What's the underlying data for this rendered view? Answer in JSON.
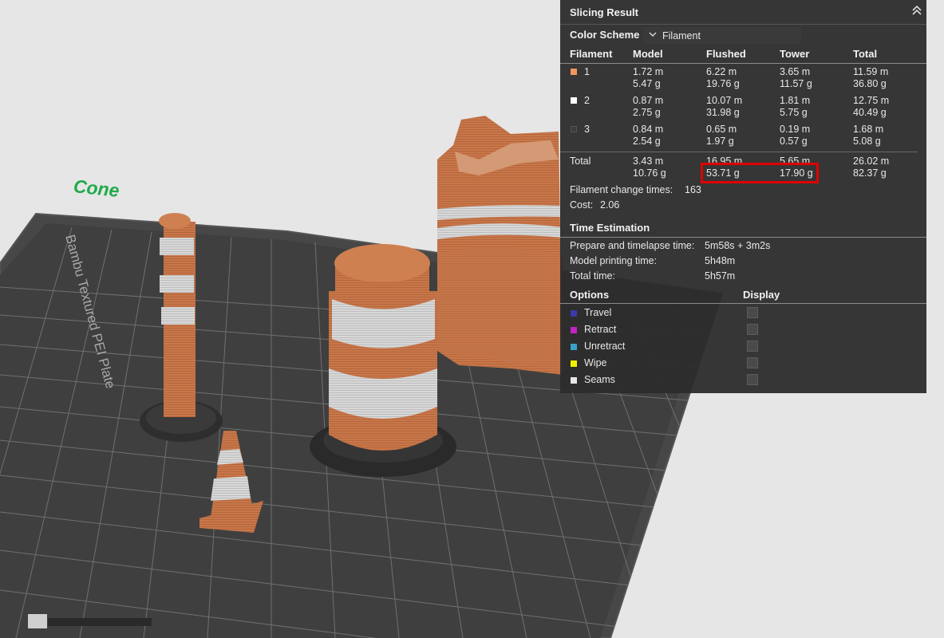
{
  "scene": {
    "object_label": "Cone",
    "plate_text": "Bambu Textured PEI Plate",
    "colors": {
      "background": "#e6e6e6",
      "plate": "#4a4a4a",
      "filament_orange": "#c8774a",
      "filament_white": "#d4d4d4"
    }
  },
  "panel": {
    "title": "Slicing Result",
    "collapse_icon": "double-chevron-up-icon",
    "color_scheme_label": "Color Scheme",
    "color_scheme_value": "Filament",
    "columns": [
      "Filament",
      "Model",
      "Flushed",
      "Tower",
      "Total"
    ],
    "rows": [
      {
        "id": "1",
        "color": "#f0965f",
        "model": [
          "1.72 m",
          "5.47 g"
        ],
        "flushed": [
          "6.22 m",
          "19.76 g"
        ],
        "tower": [
          "3.65 m",
          "11.57 g"
        ],
        "total": [
          "11.59 m",
          "36.80 g"
        ]
      },
      {
        "id": "2",
        "color": "#ffffff",
        "model": [
          "0.87 m",
          "2.75 g"
        ],
        "flushed": [
          "10.07 m",
          "31.98 g"
        ],
        "tower": [
          "1.81 m",
          "5.75 g"
        ],
        "total": [
          "12.75 m",
          "40.49 g"
        ]
      },
      {
        "id": "3",
        "color": "#3c3c3c",
        "model": [
          "0.84 m",
          "2.54 g"
        ],
        "flushed": [
          "0.65 m",
          "1.97 g"
        ],
        "tower": [
          "0.19 m",
          "0.57 g"
        ],
        "total": [
          "1.68 m",
          "5.08 g"
        ]
      }
    ],
    "total_row": {
      "label": "Total",
      "model": [
        "3.43 m",
        "10.76 g"
      ],
      "flushed": [
        "16.95 m",
        "53.71 g"
      ],
      "tower": [
        "5.65 m",
        "17.90 g"
      ],
      "total": [
        "26.02 m",
        "82.37 g"
      ]
    },
    "filament_change_label": "Filament change times:",
    "filament_change_value": "163",
    "cost_label": "Cost:",
    "cost_value": "2.06",
    "time_title": "Time Estimation",
    "time_rows": [
      {
        "label": "Prepare and timelapse time:",
        "value": "5m58s + 3m2s"
      },
      {
        "label": "Model printing time:",
        "value": "5h48m"
      },
      {
        "label": "Total time:",
        "value": "5h57m"
      }
    ],
    "options_label": "Options",
    "display_label": "Display",
    "options": [
      {
        "label": "Travel",
        "color": "#3a3aa8"
      },
      {
        "label": "Retract",
        "color": "#c423c4"
      },
      {
        "label": "Unretract",
        "color": "#3aa0c8"
      },
      {
        "label": "Wipe",
        "color": "#f0f000"
      },
      {
        "label": "Seams",
        "color": "#e6e6e6"
      }
    ],
    "highlight_color": "#e00000"
  }
}
